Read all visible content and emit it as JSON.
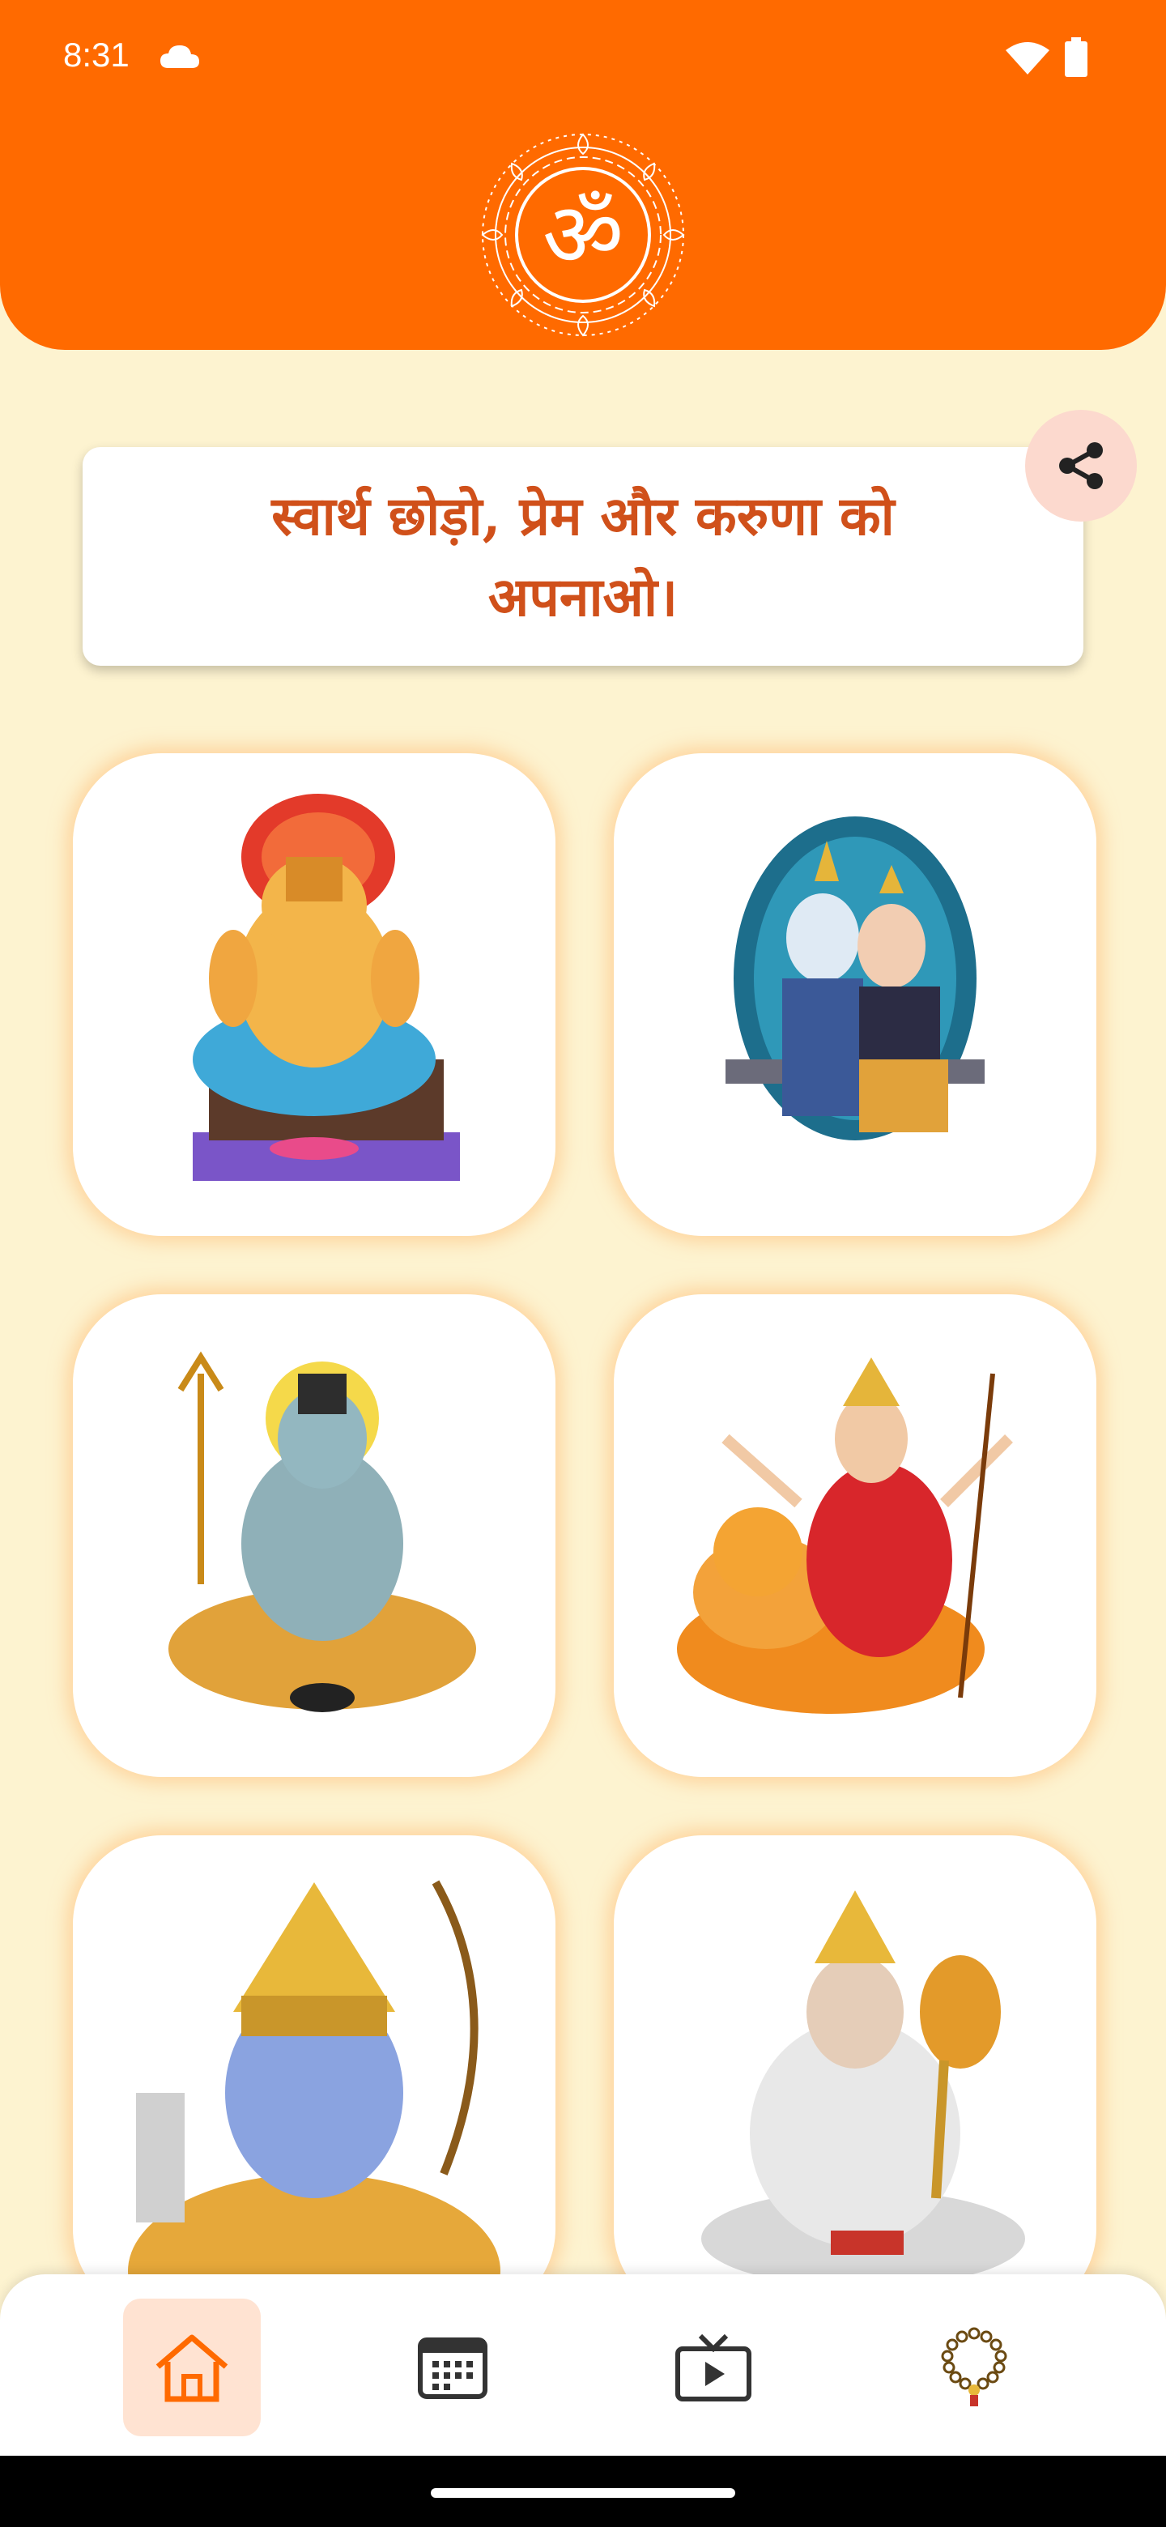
{
  "status": {
    "time": "8:31"
  },
  "quote": {
    "text": "स्वार्थ छोड़ो, प्रेम और करुणा को अपनाओ।"
  },
  "colors": {
    "primary": "#ff6a00",
    "background": "#fdf3d0",
    "quote_text": "#d0501a",
    "active_tab_bg": "#ffe3d2"
  },
  "deities": [
    {
      "name": "ganesha"
    },
    {
      "name": "radha-krishna"
    },
    {
      "name": "shiva"
    },
    {
      "name": "durga"
    },
    {
      "name": "rama"
    },
    {
      "name": "hanuman"
    }
  ],
  "nav": {
    "items": [
      {
        "icon": "home-icon",
        "active": true
      },
      {
        "icon": "calendar-icon",
        "active": false
      },
      {
        "icon": "tv-icon",
        "active": false
      },
      {
        "icon": "mala-icon",
        "active": false
      }
    ]
  }
}
